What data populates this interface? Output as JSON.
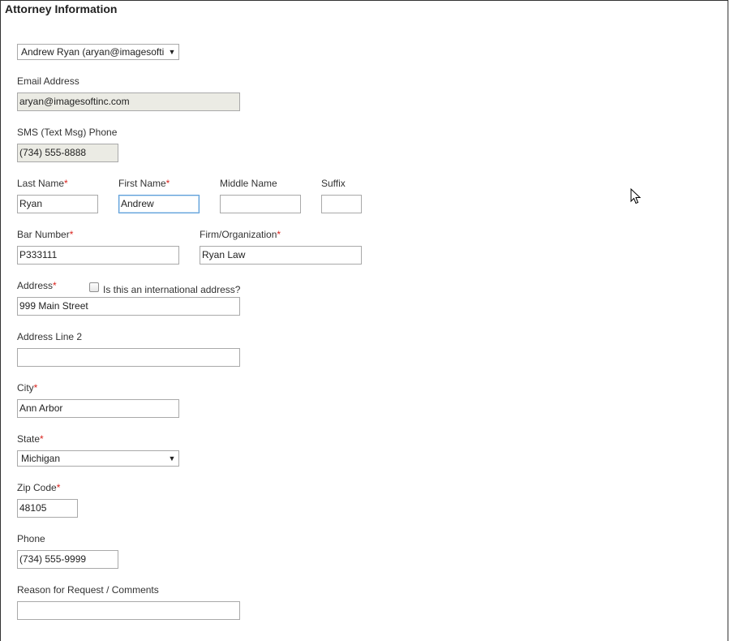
{
  "section_title": "Attorney Information",
  "attorney_select": {
    "value": "Andrew Ryan (aryan@imagesofti"
  },
  "email": {
    "label": "Email Address",
    "value": "aryan@imagesoftinc.com"
  },
  "sms": {
    "label": "SMS (Text Msg) Phone",
    "value": "(734) 555-8888"
  },
  "last_name": {
    "label": "Last Name",
    "value": "Ryan"
  },
  "first_name": {
    "label": "First Name",
    "value": "Andrew"
  },
  "middle_name": {
    "label": "Middle Name",
    "value": ""
  },
  "suffix": {
    "label": "Suffix",
    "value": ""
  },
  "bar_number": {
    "label": "Bar Number",
    "value": "P333111"
  },
  "firm": {
    "label": "Firm/Organization",
    "value": "Ryan Law"
  },
  "address": {
    "label": "Address",
    "value": "999 Main Street"
  },
  "international": {
    "label": "Is this an international address?",
    "checked": false
  },
  "address2": {
    "label": "Address Line 2",
    "value": ""
  },
  "city": {
    "label": "City",
    "value": "Ann Arbor"
  },
  "state": {
    "label": "State",
    "value": "Michigan"
  },
  "zip": {
    "label": "Zip Code",
    "value": "48105"
  },
  "phone": {
    "label": "Phone",
    "value": "(734) 555-9999"
  },
  "comments": {
    "label": "Reason for Request / Comments",
    "value": ""
  },
  "required_marker": "*",
  "icons": {
    "dropdown": "triangle-down-icon",
    "cursor": "mouse-pointer-icon"
  },
  "colors": {
    "required": "#d9231d",
    "readonly_bg": "#ebebe4",
    "focus_border": "#5b9dd9"
  }
}
